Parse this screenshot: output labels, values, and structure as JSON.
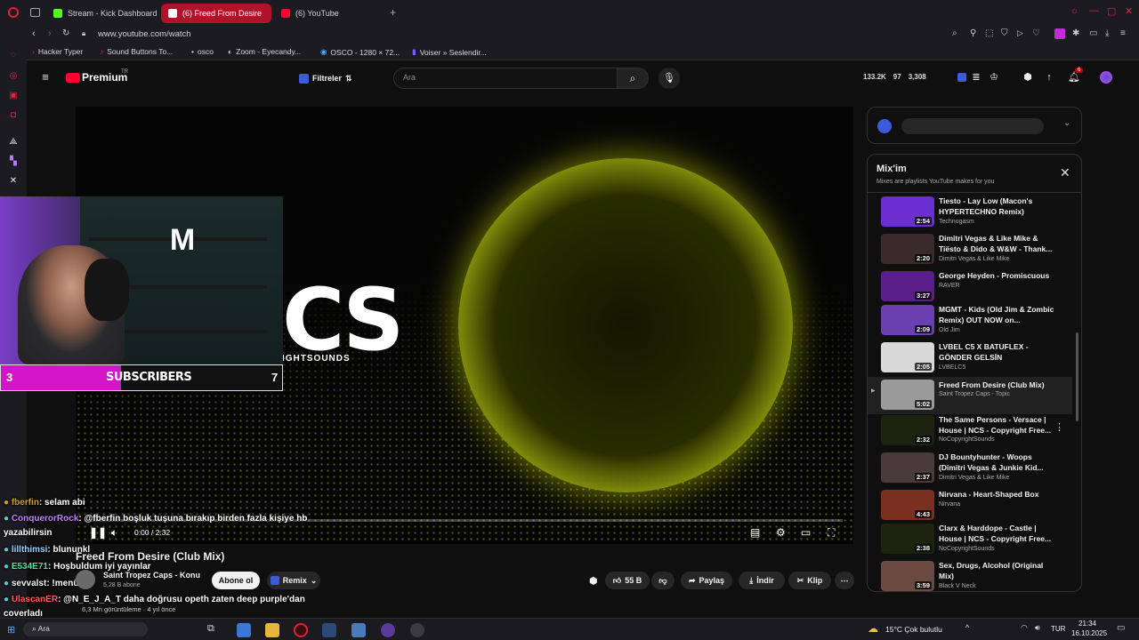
{
  "tabs": [
    {
      "label": "Stream - Kick Dashboard",
      "color": "#53fc18"
    },
    {
      "label": "(6) Freed From Desire",
      "color": "#ff0033"
    },
    {
      "label": "(6) YouTube",
      "color": "#ff0033"
    }
  ],
  "address": {
    "url": "www.youtube.com/watch"
  },
  "bookmarks": [
    "Hacker Typer",
    "Sound Buttons To...",
    "osco",
    "Zoom - Eyecandy...",
    "OSCO - 1280 × 72...",
    "Voiser » Seslendir..."
  ],
  "yt": {
    "logo": "Premium",
    "logo_sup": "TR",
    "filter_label": "Filtreler",
    "search_placeholder": "Ara",
    "stats": {
      "views": "133.2K",
      "likes": "97",
      "watchers": "3,308"
    },
    "notif_count": "6"
  },
  "player": {
    "brand_text": "CS",
    "brand_sub": "IGHTSOUNDS",
    "time": "0:00 / 2:32"
  },
  "cam": {
    "left_num": "3",
    "label": "SUBSCRIBERS",
    "right_num": "7"
  },
  "chat": [
    {
      "user": "fberfin",
      "text": ": selam abi"
    },
    {
      "user": "ConquerorRock",
      "text": ": @fberfin boşluk tuşuna bırakıp birden fazla kişiye hb"
    },
    {
      "user": "",
      "text": "yazabilirsin"
    },
    {
      "user": "lillthimsi",
      "text": ": blununkl"
    },
    {
      "user": "E534E71",
      "text": ": Hoşbuldum iyi yayınlar"
    },
    {
      "user": "sevvalst",
      "text": ": !menü"
    },
    {
      "user": "UlascanER",
      "text": ": @N_E_J_A_T daha doğrusu opeth zaten deep purple'dan"
    },
    {
      "user": "",
      "text": "coverladı"
    }
  ],
  "video": {
    "title": "Freed From Desire (Club Mix)",
    "channel": "Saint Tropez Caps - Konu",
    "subs": "5,28 B abone",
    "subscribe_label": "Abone ol",
    "remix_label": "Remix",
    "likes": "55 B",
    "share_label": "Paylaş",
    "download_label": "İndir",
    "clip_label": "Klip",
    "meta": "6,3 Mn görüntüleme · 4 yıl önce"
  },
  "mix": {
    "title": "Mix'im",
    "subtitle": "Mixes are playlists YouTube makes for you",
    "items": [
      {
        "title": "Tiesto - Lay Low (Macon's HYPERTECHNO Remix)",
        "channel": "Technogasm",
        "dur": "2:54",
        "color": "#6b2fd1"
      },
      {
        "title": "Dimitri Vegas & Like Mike & Tiësto & Dido & W&W - Thank...",
        "channel": "Dimitri Vegas & Like Mike",
        "dur": "2:20",
        "color": "#3a2a2a"
      },
      {
        "title": "George Heyden - Promiscuous",
        "channel": "RAVER",
        "dur": "3:27",
        "color": "#5a1e8a"
      },
      {
        "title": "MGMT - Kids (Old Jim & Zombic Remix) OUT NOW on...",
        "channel": "Old Jim",
        "dur": "2:09",
        "color": "#6a3fb0"
      },
      {
        "title": "LVBEL C5 X BATUFLEX - GÖNDER GELSİN",
        "channel": "LVBELC5",
        "dur": "2:05",
        "color": "#d8d8d8"
      },
      {
        "title": "Freed From Desire (Club Mix)",
        "channel": "Saint Tropez Caps - Topic",
        "dur": "5:02",
        "color": "#9a9a9a"
      },
      {
        "title": "The Same Persons - Versace | House | NCS - Copyright Free...",
        "channel": "NoCopyrightSounds",
        "dur": "2:32",
        "color": "#1c2410"
      },
      {
        "title": "DJ Bountyhunter - Woops (Dimitri Vegas & Junkie Kid...",
        "channel": "Dimitri Vegas & Like Mike",
        "dur": "2:37",
        "color": "#4a3a3a"
      },
      {
        "title": "Nirvana - Heart-Shaped Box",
        "channel": "Nirvana",
        "dur": "4:43",
        "color": "#7a3020"
      },
      {
        "title": "Clarx & Harddope - Castle | House | NCS - Copyright Free...",
        "channel": "NoCopyrightSounds",
        "dur": "2:38",
        "color": "#1c2410"
      },
      {
        "title": "Sex, Drugs, Alcohol (Original Mix)",
        "channel": "Black V Neck",
        "dur": "3:59",
        "color": "#6a4a40"
      }
    ]
  },
  "taskbar": {
    "start_text": "Ara",
    "weather": "15°C  Çok bulutlu",
    "lang": "TUR",
    "time": "21:34",
    "date": "16.10.2025"
  }
}
